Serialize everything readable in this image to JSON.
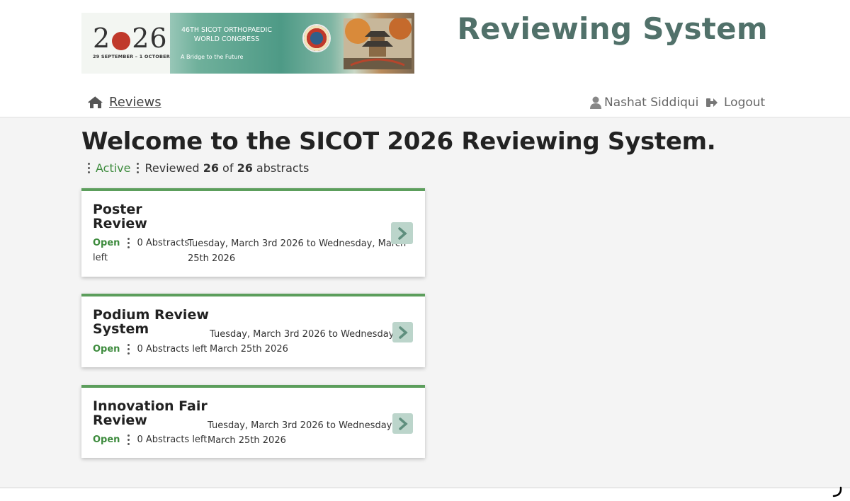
{
  "header": {
    "site_title": "Reviewing System",
    "banner": {
      "year": "2026",
      "logo_text": "SICOT",
      "dates": "29 SEPTEMBER – 1 OCTOBER",
      "congress_line1": "46TH SICOT ORTHOPAEDIC",
      "congress_line2": "WORLD CONGRESS",
      "tagline": "A Bridge to the Future"
    }
  },
  "nav": {
    "reviews_label": "Reviews",
    "user_name": "Nashat Siddiqui",
    "logout_label": "Logout"
  },
  "main": {
    "welcome": "Welcome to the SICOT 2026 Reviewing System.",
    "status": "Active",
    "reviewed_prefix": "Reviewed",
    "reviewed_count": "26",
    "reviewed_of": "of",
    "reviewed_total": "26",
    "reviewed_suffix": "abstracts"
  },
  "cards": [
    {
      "title_line1": "Poster",
      "title_line2": "Review",
      "status": "Open",
      "abstracts_left_a": "0 Abstracts",
      "abstracts_left_b": "left",
      "dates_line1": "Tuesday, March 3rd 2026 to Wednesday, March",
      "dates_line2": "25th 2026"
    },
    {
      "title_line1": "Podium Review",
      "title_line2": "System",
      "status": "Open",
      "abstracts_left": "0 Abstracts left",
      "dates_line1": "Tuesday, March 3rd 2026 to Wednesday,",
      "dates_line2": "March 25th 2026"
    },
    {
      "title_line1": "Innovation Fair",
      "title_line2": "Review",
      "status": "Open",
      "abstracts_left": "0 Abstracts left",
      "dates_line1": "Tuesday, March 3rd 2026 to Wednesday,",
      "dates_line2": "March 25th 2026"
    }
  ],
  "colors": {
    "accent_green": "#5c9e5c",
    "title_teal": "#51716a",
    "open_green": "#3d8b3d",
    "arrow_bg": "#bcd5cb"
  },
  "icons": {
    "home": "home-icon",
    "user": "user-icon",
    "logout": "logout-icon",
    "chevron": "chevron-right-icon"
  }
}
